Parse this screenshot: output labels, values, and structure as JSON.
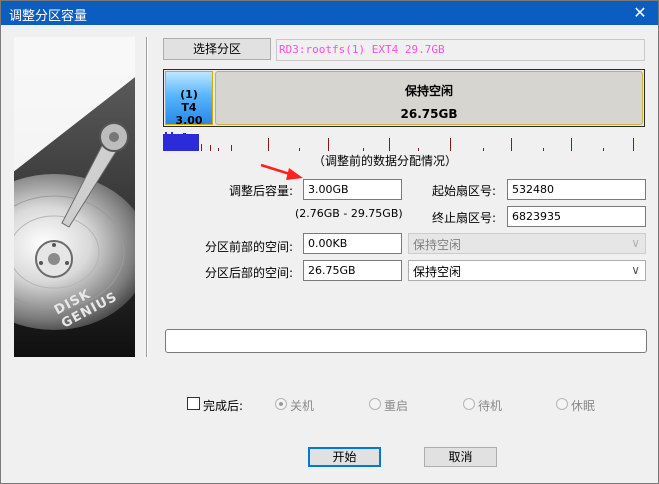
{
  "window": {
    "title": "调整分区容量",
    "close_glyph": "✕"
  },
  "branding": {
    "logo_text": "DISK GENIUS"
  },
  "partition": {
    "select_button_label": "选择分区",
    "info_text": "RD3:rootfs(1) EXT4 29.7GB",
    "used_segment_line1": "(1)",
    "used_segment_line2": "T4 3.00",
    "free_segment_title": "保持空闲",
    "free_segment_size": "26.75GB"
  },
  "section_caption": "（调整前的数据分配情况）",
  "form": {
    "size_after_label": "调整后容量:",
    "size_after_value": "3.00GB",
    "size_range_hint": "(2.76GB - 29.75GB)",
    "start_sector_label": "起始扇区号:",
    "start_sector_value": "532480",
    "end_sector_label": "终止扇区号:",
    "end_sector_value": "6823935",
    "space_before_label": "分区前部的空间:",
    "space_before_value": "0.00KB",
    "space_before_option": "保持空闲",
    "space_after_label": "分区后部的空间:",
    "space_after_value": "26.75GB",
    "space_after_option": "保持空闲"
  },
  "progress": {
    "fraction": 0
  },
  "completion": {
    "checkbox_label": "完成后:",
    "checked": false,
    "options": [
      "关机",
      "重启",
      "待机",
      "休眠"
    ],
    "selected_index": 0
  },
  "buttons": {
    "start_label": "开始",
    "cancel_label": "取消"
  },
  "colors": {
    "title_bar": "#0b5dc2",
    "info_text": "#ff4de6",
    "annotation_arrow": "#ff2020",
    "used_segment": "#3a96ef"
  }
}
